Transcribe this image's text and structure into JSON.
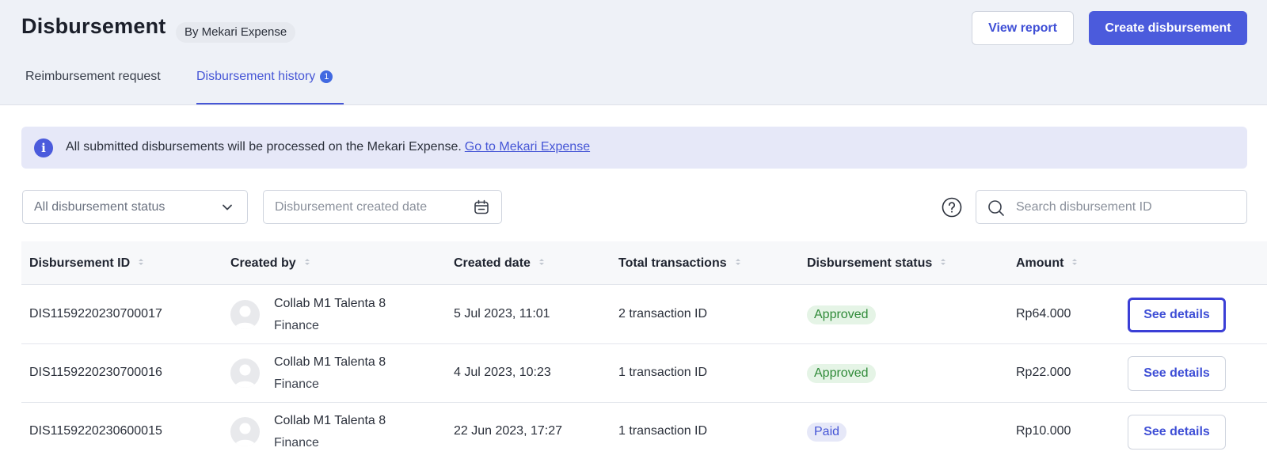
{
  "header": {
    "title": "Disbursement",
    "subtitle": "By Mekari Expense",
    "view_report_label": "View report",
    "create_label": "Create disbursement"
  },
  "tabs": [
    {
      "label": "Reimbursement request",
      "active": false
    },
    {
      "label": "Disbursement history",
      "active": true,
      "badge": "1"
    }
  ],
  "banner": {
    "icon": "info-icon",
    "text": "All submitted disbursements will be processed on the Mekari Expense.",
    "link": "Go to Mekari Expense"
  },
  "filters": {
    "status_value": "All disbursement status",
    "date_placeholder": "Disbursement created date",
    "search_placeholder": "Search disbursement ID"
  },
  "table": {
    "columns": [
      "Disbursement ID",
      "Created by",
      "Created date",
      "Total transactions",
      "Disbursement status",
      "Amount"
    ],
    "rows": [
      {
        "id": "DIS1159220230700017",
        "created_by": "Collab M1 Talenta 8",
        "dept": "Finance",
        "date": "5 Jul 2023, 11:01",
        "transactions": "2 transaction ID",
        "status": "Approved",
        "amount": "Rp64.000",
        "action": "See details"
      },
      {
        "id": "DIS1159220230700016",
        "created_by": "Collab M1 Talenta 8",
        "dept": "Finance",
        "date": "4 Jul 2023, 10:23",
        "transactions": "1 transaction ID",
        "status": "Approved",
        "amount": "Rp22.000",
        "action": "See details"
      },
      {
        "id": "DIS1159220230600015",
        "created_by": "Collab M1 Talenta 8",
        "dept": "Finance",
        "date": "22 Jun 2023, 17:27",
        "transactions": "1 transaction ID",
        "status": "Paid",
        "amount": "Rp10.000",
        "action": "See details"
      }
    ]
  },
  "colors": {
    "primary": "#4b5bdc",
    "approved_text": "#2f8a38",
    "approved_bg": "#e5f4e6",
    "paid_text": "#4656d6",
    "paid_bg": "#e6e8f8"
  }
}
